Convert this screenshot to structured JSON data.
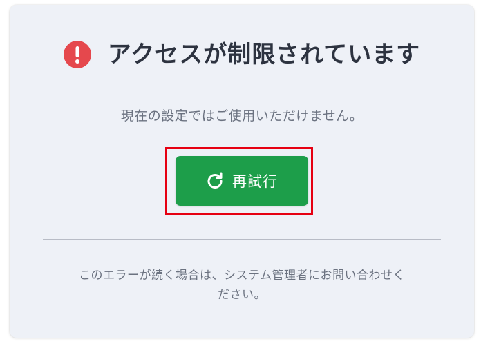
{
  "title": "アクセスが制限されています",
  "message": "現在の設定ではご使用いただけません。",
  "retry_button": {
    "label": "再試行",
    "icon": "refresh-icon"
  },
  "footer": {
    "line1": "このエラーが続く場合は、システム管理者にお問い合わせく",
    "line2": "ださい。"
  },
  "colors": {
    "alert": "#e5484d",
    "button": "#1d9e4a",
    "highlight": "#e60012"
  }
}
